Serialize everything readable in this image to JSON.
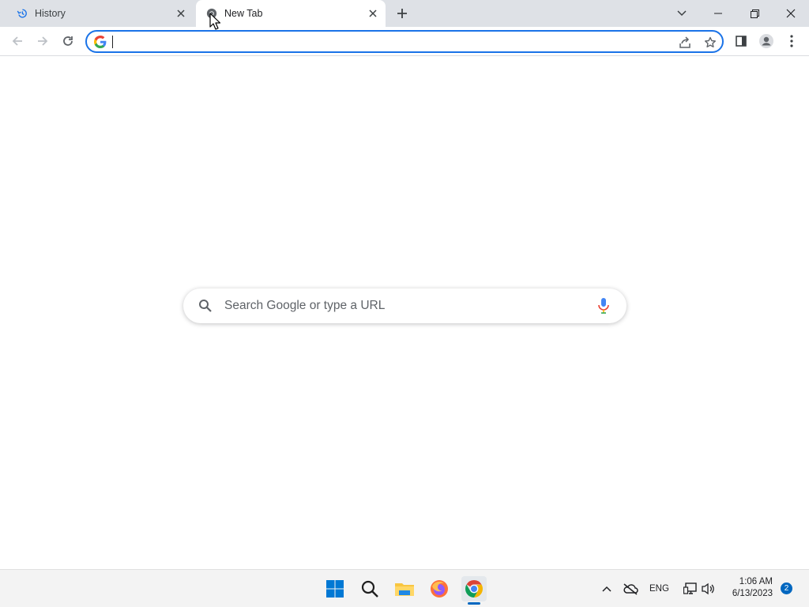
{
  "browser": {
    "tabs": [
      {
        "title": "History",
        "icon": "history-icon",
        "active": false
      },
      {
        "title": "New Tab",
        "icon": "chrome-icon",
        "active": true
      }
    ],
    "omnibox": {
      "value": "",
      "placeholder": ""
    }
  },
  "ntp": {
    "search_placeholder": "Search Google or type a URL"
  },
  "taskbar": {
    "language": "ENG",
    "time": "1:06 AM",
    "date": "6/13/2023",
    "notification_count": "2",
    "apps": [
      "start-icon",
      "search-icon",
      "file-explorer-icon",
      "firefox-icon",
      "chrome-icon"
    ]
  },
  "colors": {
    "accent": "#1a73e8",
    "tabstrip_bg": "#dee1e6",
    "windows_blue": "#0067c0"
  }
}
